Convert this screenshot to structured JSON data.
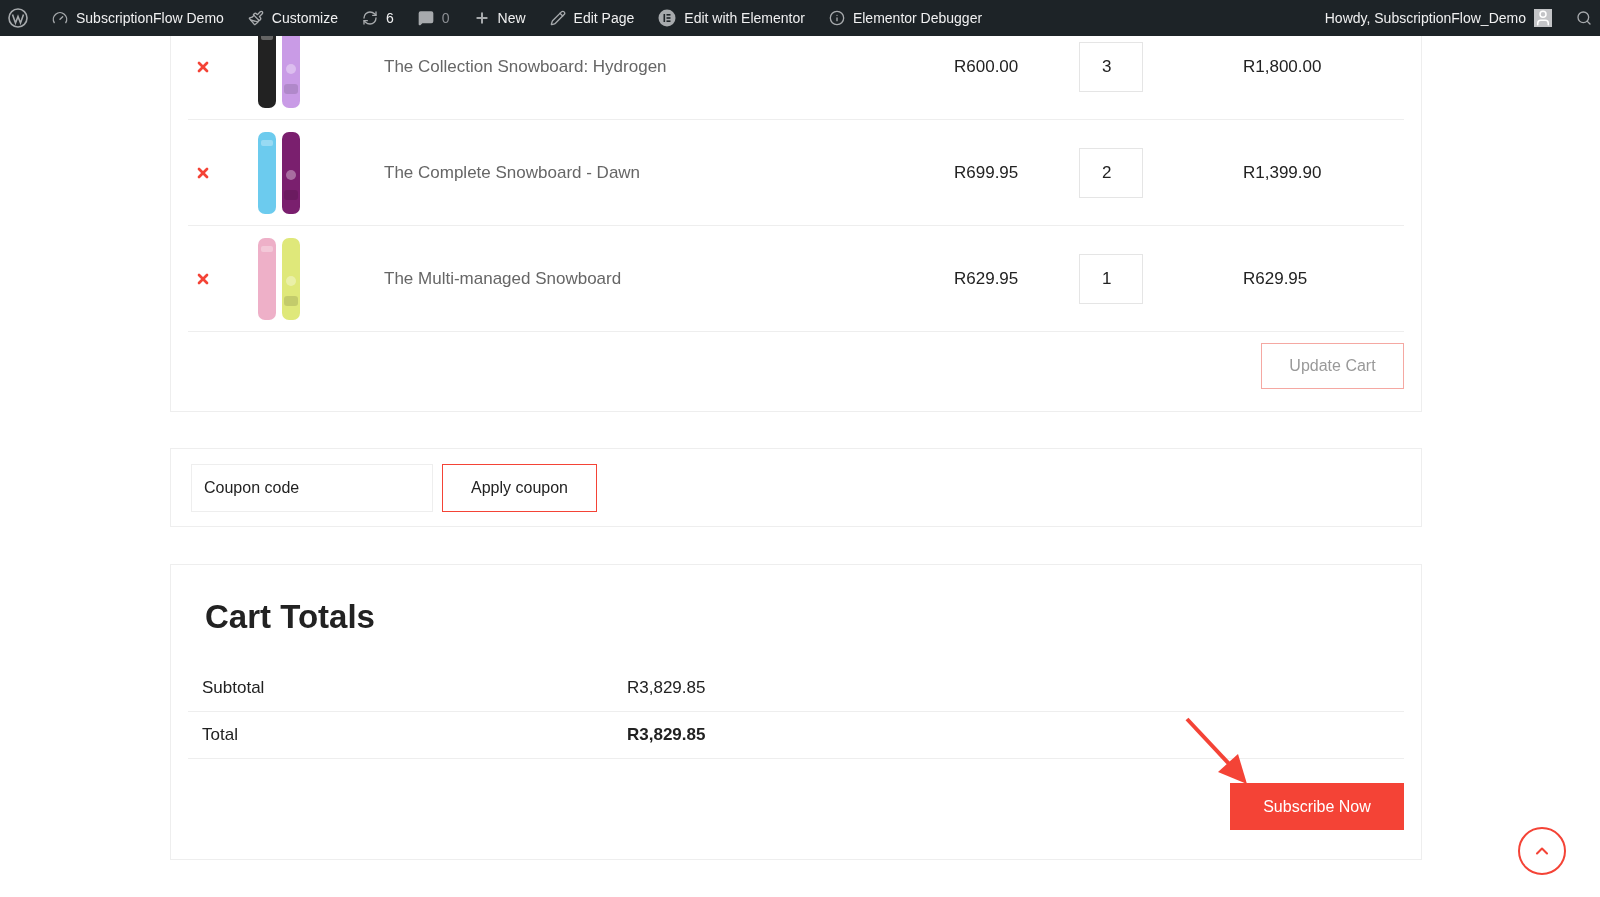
{
  "admin_bar": {
    "items": [
      {
        "kind": "wp"
      },
      {
        "kind": "site",
        "label": "SubscriptionFlow Demo"
      },
      {
        "kind": "brush",
        "label": "Customize"
      },
      {
        "kind": "updates",
        "label": "6"
      },
      {
        "kind": "comments",
        "label": "0"
      },
      {
        "kind": "plus",
        "label": "New"
      },
      {
        "kind": "pencil",
        "label": "Edit Page"
      },
      {
        "kind": "elementor",
        "label": "Edit with Elementor"
      },
      {
        "kind": "info",
        "label": "Elementor Debugger"
      }
    ],
    "account": "Howdy, SubscriptionFlow_Demo"
  },
  "cart": {
    "rows": [
      {
        "name": "The Collection Snowboard: Hydrogen",
        "price": "R600.00",
        "quantity": "3",
        "subtotal": "R1,800.00"
      },
      {
        "name": "The Complete Snowboard - Dawn",
        "price": "R699.95",
        "quantity": "2",
        "subtotal": "R1,399.90"
      },
      {
        "name": "The Multi-managed Snowboard",
        "price": "R629.95",
        "quantity": "1",
        "subtotal": "R629.95"
      }
    ],
    "update_button": "Update Cart"
  },
  "coupon": {
    "placeholder": "Coupon code",
    "button": "Apply coupon"
  },
  "totals": {
    "title": "Cart Totals",
    "rows": [
      {
        "label": "Subtotal",
        "value": "R3,829.85",
        "bold": false
      },
      {
        "label": "Total",
        "value": "R3,829.85",
        "bold": true
      }
    ],
    "button": "Subscribe Now"
  }
}
